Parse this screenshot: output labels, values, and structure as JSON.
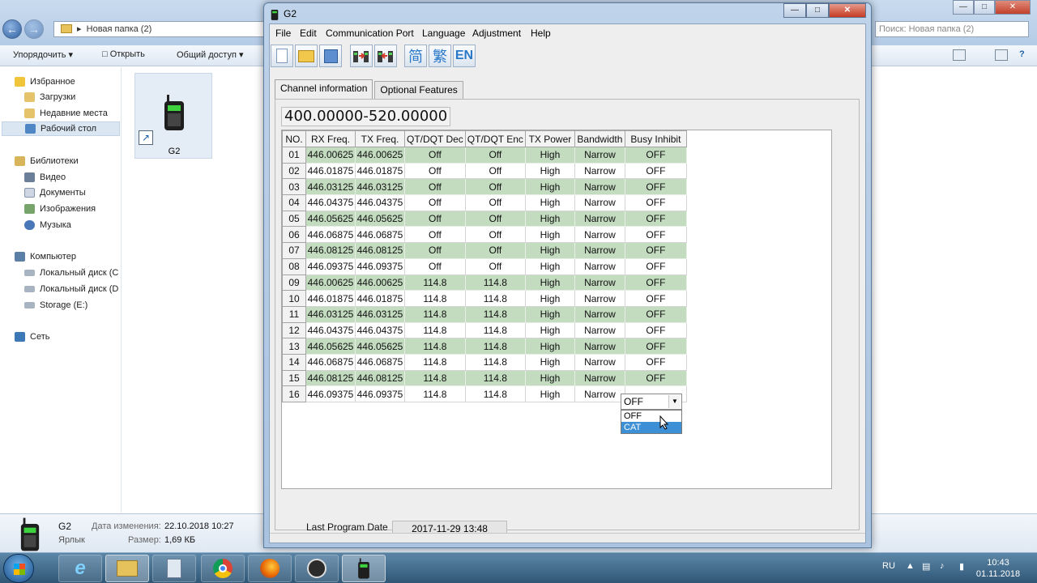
{
  "explorer": {
    "breadcrumb": "Новая папка (2)",
    "search_placeholder": "Поиск: Новая папка (2)",
    "toolbar": {
      "organize": "Упорядочить",
      "open": "Открыть",
      "share": "Общий доступ"
    },
    "sidebar": {
      "favorites": "Избранное",
      "downloads": "Загрузки",
      "recent": "Недавние места",
      "desktop": "Рабочий стол",
      "libraries": "Библиотеки",
      "video": "Видео",
      "documents": "Документы",
      "images": "Изображения",
      "music": "Музыка",
      "computer": "Компьютер",
      "disk_c": "Локальный диск (C",
      "disk_d": "Локальный диск (D",
      "storage_e": "Storage (E:)",
      "network": "Сеть"
    },
    "file": {
      "name": "G2"
    },
    "details": {
      "name": "G2",
      "type": "Ярлык",
      "modified_label": "Дата изменения:",
      "modified_value": "22.10.2018 10:27",
      "size_label": "Размер:",
      "size_value": "1,69 КБ"
    }
  },
  "taskbar": {
    "lang": "RU",
    "time": "10:43",
    "date": "01.11.2018"
  },
  "app": {
    "title": "G2",
    "menu": [
      "File",
      "Edit",
      "Communication Port",
      "Language",
      "Adjustment",
      "Help"
    ],
    "lang_buttons": {
      "simplified": "简",
      "traditional": "繁",
      "english": "EN"
    },
    "tabs": [
      "Channel information",
      "Optional Features"
    ],
    "freq_range": "400.00000-520.00000",
    "columns": [
      "NO.",
      "RX Freq.",
      "TX Freq.",
      "QT/DQT Dec",
      "QT/DQT Enc",
      "TX Power",
      "Bandwidth",
      "Busy Inhibit"
    ],
    "channels": [
      [
        "01",
        "446.00625",
        "446.00625",
        "Off",
        "Off",
        "High",
        "Narrow",
        "OFF"
      ],
      [
        "02",
        "446.01875",
        "446.01875",
        "Off",
        "Off",
        "High",
        "Narrow",
        "OFF"
      ],
      [
        "03",
        "446.03125",
        "446.03125",
        "Off",
        "Off",
        "High",
        "Narrow",
        "OFF"
      ],
      [
        "04",
        "446.04375",
        "446.04375",
        "Off",
        "Off",
        "High",
        "Narrow",
        "OFF"
      ],
      [
        "05",
        "446.05625",
        "446.05625",
        "Off",
        "Off",
        "High",
        "Narrow",
        "OFF"
      ],
      [
        "06",
        "446.06875",
        "446.06875",
        "Off",
        "Off",
        "High",
        "Narrow",
        "OFF"
      ],
      [
        "07",
        "446.08125",
        "446.08125",
        "Off",
        "Off",
        "High",
        "Narrow",
        "OFF"
      ],
      [
        "08",
        "446.09375",
        "446.09375",
        "Off",
        "Off",
        "High",
        "Narrow",
        "OFF"
      ],
      [
        "09",
        "446.00625",
        "446.00625",
        "114.8",
        "114.8",
        "High",
        "Narrow",
        "OFF"
      ],
      [
        "10",
        "446.01875",
        "446.01875",
        "114.8",
        "114.8",
        "High",
        "Narrow",
        "OFF"
      ],
      [
        "11",
        "446.03125",
        "446.03125",
        "114.8",
        "114.8",
        "High",
        "Narrow",
        "OFF"
      ],
      [
        "12",
        "446.04375",
        "446.04375",
        "114.8",
        "114.8",
        "High",
        "Narrow",
        "OFF"
      ],
      [
        "13",
        "446.05625",
        "446.05625",
        "114.8",
        "114.8",
        "High",
        "Narrow",
        "OFF"
      ],
      [
        "14",
        "446.06875",
        "446.06875",
        "114.8",
        "114.8",
        "High",
        "Narrow",
        "OFF"
      ],
      [
        "15",
        "446.08125",
        "446.08125",
        "114.8",
        "114.8",
        "High",
        "Narrow",
        "OFF"
      ],
      [
        "16",
        "446.09375",
        "446.09375",
        "114.8",
        "114.8",
        "High",
        "Narrow",
        ""
      ]
    ],
    "busy_dropdown": {
      "selected": "OFF",
      "options": [
        "OFF",
        "CAT"
      ],
      "highlighted": "CAT"
    },
    "last_program_date_label": "Last Program Date",
    "last_program_date": "2017-11-29  13:48",
    "colors": {
      "row_green": "#c3dcc0",
      "selection": "#3d8fd6"
    }
  }
}
